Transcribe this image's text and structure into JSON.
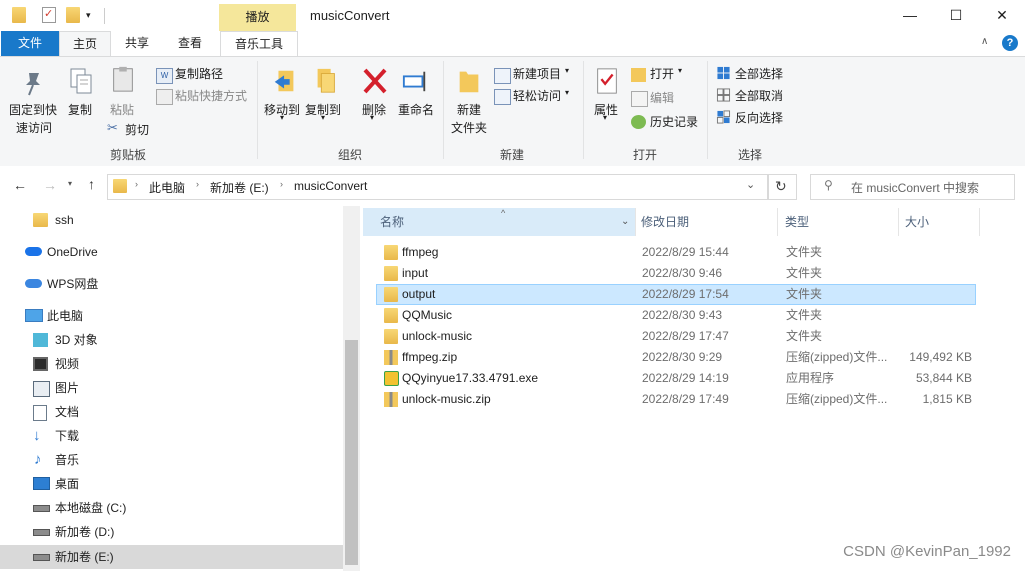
{
  "window": {
    "title": "musicConvert",
    "context_tab": "播放",
    "buttons": {
      "minimize": "—",
      "maximize": "☐",
      "close": "✕"
    }
  },
  "tabs": [
    {
      "label": "文件"
    },
    {
      "label": "主页"
    },
    {
      "label": "共享"
    },
    {
      "label": "查看"
    },
    {
      "label": "音乐工具"
    }
  ],
  "ribbon": {
    "clipboard": {
      "group": "剪贴板",
      "pin_line1": "固定到快",
      "pin_line2": "速访问",
      "copy": "复制",
      "paste": "粘贴",
      "copy_path": "复制路径",
      "paste_shortcut": "粘贴快捷方式",
      "cut": "剪切"
    },
    "organize": {
      "group": "组织",
      "move_to": "移动到",
      "copy_to": "复制到",
      "delete": "删除",
      "rename": "重命名"
    },
    "new": {
      "group": "新建",
      "new_folder_line1": "新建",
      "new_folder_line2": "文件夹",
      "new_item": "新建项目",
      "easy_access": "轻松访问"
    },
    "open": {
      "group": "打开",
      "properties": "属性",
      "open": "打开",
      "edit": "编辑",
      "history": "历史记录"
    },
    "select": {
      "group": "选择",
      "select_all": "全部选择",
      "select_none": "全部取消",
      "invert": "反向选择"
    }
  },
  "address": {
    "crumbs": [
      "此电脑",
      "新加卷 (E:)",
      "musicConvert"
    ],
    "search_placeholder": "在 musicConvert 中搜索"
  },
  "nav": [
    {
      "label": "ssh"
    },
    {
      "label": "OneDrive"
    },
    {
      "label": "WPS网盘"
    },
    {
      "label": "此电脑"
    },
    {
      "label": "3D 对象"
    },
    {
      "label": "视频"
    },
    {
      "label": "图片"
    },
    {
      "label": "文档"
    },
    {
      "label": "下载"
    },
    {
      "label": "音乐"
    },
    {
      "label": "桌面"
    },
    {
      "label": "本地磁盘 (C:)"
    },
    {
      "label": "新加卷 (D:)"
    },
    {
      "label": "新加卷 (E:)"
    }
  ],
  "columns": {
    "name": "名称",
    "date": "修改日期",
    "type": "类型",
    "size": "大小"
  },
  "files": [
    {
      "name": "ffmpeg",
      "date": "2022/8/29 15:44",
      "type": "文件夹",
      "size": ""
    },
    {
      "name": "input",
      "date": "2022/8/30 9:46",
      "type": "文件夹",
      "size": ""
    },
    {
      "name": "output",
      "date": "2022/8/29 17:54",
      "type": "文件夹",
      "size": ""
    },
    {
      "name": "QQMusic",
      "date": "2022/8/30 9:43",
      "type": "文件夹",
      "size": ""
    },
    {
      "name": "unlock-music",
      "date": "2022/8/29 17:47",
      "type": "文件夹",
      "size": ""
    },
    {
      "name": "ffmpeg.zip",
      "date": "2022/8/30 9:29",
      "type": "压缩(zipped)文件...",
      "size": "149,492 KB"
    },
    {
      "name": "QQyinyue17.33.4791.exe",
      "date": "2022/8/29 14:19",
      "type": "应用程序",
      "size": "53,844 KB"
    },
    {
      "name": "unlock-music.zip",
      "date": "2022/8/29 17:49",
      "type": "压缩(zipped)文件...",
      "size": "1,815 KB"
    }
  ],
  "watermark": "CSDN @KevinPan_1992",
  "colors": {
    "accent": "#1979ca",
    "selected_row": "#cce8ff",
    "folder": "#f0c54f"
  }
}
